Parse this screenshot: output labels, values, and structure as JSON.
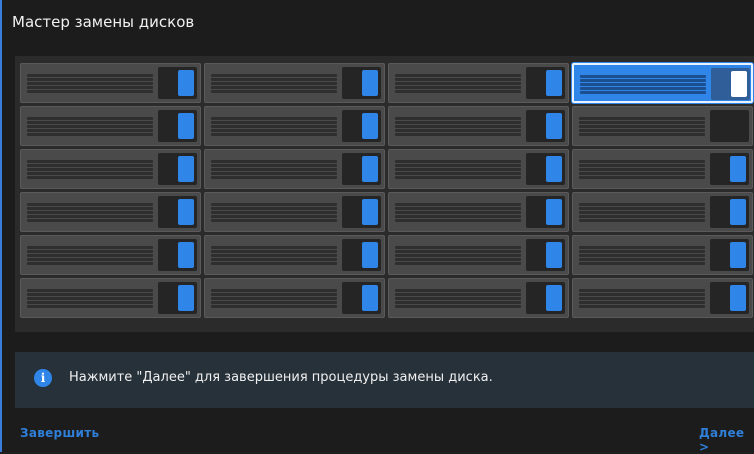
{
  "window": {
    "title": "Мастер замены дисков"
  },
  "rack": {
    "rows": 6,
    "columns": 4,
    "bays": [
      {
        "state": "installed"
      },
      {
        "state": "installed"
      },
      {
        "state": "installed"
      },
      {
        "state": "selected"
      },
      {
        "state": "installed"
      },
      {
        "state": "installed"
      },
      {
        "state": "installed"
      },
      {
        "state": "empty"
      },
      {
        "state": "installed"
      },
      {
        "state": "installed"
      },
      {
        "state": "installed"
      },
      {
        "state": "installed"
      },
      {
        "state": "installed"
      },
      {
        "state": "installed"
      },
      {
        "state": "installed"
      },
      {
        "state": "installed"
      },
      {
        "state": "installed"
      },
      {
        "state": "installed"
      },
      {
        "state": "installed"
      },
      {
        "state": "installed"
      },
      {
        "state": "installed"
      },
      {
        "state": "installed"
      },
      {
        "state": "installed"
      },
      {
        "state": "installed"
      }
    ]
  },
  "info": {
    "icon": "info-icon",
    "message": "Нажмите \"Далее\" для завершения процедуры замены диска."
  },
  "footer": {
    "finish_label": "Завершить",
    "next_label": "Далее >"
  },
  "colors": {
    "accent": "#2f86e8",
    "background": "#1c1c1c"
  }
}
